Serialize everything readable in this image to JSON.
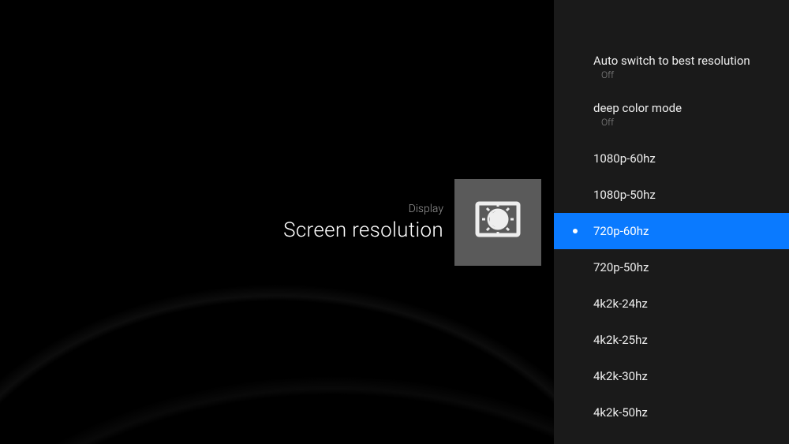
{
  "header": {
    "breadcrumb": "Display",
    "title": "Screen resolution"
  },
  "menu": {
    "toggles": [
      {
        "label": "Auto switch to best resolution",
        "value": "Off"
      },
      {
        "label": "deep color mode",
        "value": "Off"
      }
    ],
    "resolutions": [
      {
        "label": "1080p-60hz",
        "selected": false
      },
      {
        "label": "1080p-50hz",
        "selected": false
      },
      {
        "label": "720p-60hz",
        "selected": true
      },
      {
        "label": "720p-50hz",
        "selected": false
      },
      {
        "label": "4k2k-24hz",
        "selected": false
      },
      {
        "label": "4k2k-25hz",
        "selected": false
      },
      {
        "label": "4k2k-30hz",
        "selected": false
      },
      {
        "label": "4k2k-50hz",
        "selected": false
      }
    ]
  },
  "colors": {
    "accent": "#0a7aff",
    "panel": "#1a1a1a"
  }
}
